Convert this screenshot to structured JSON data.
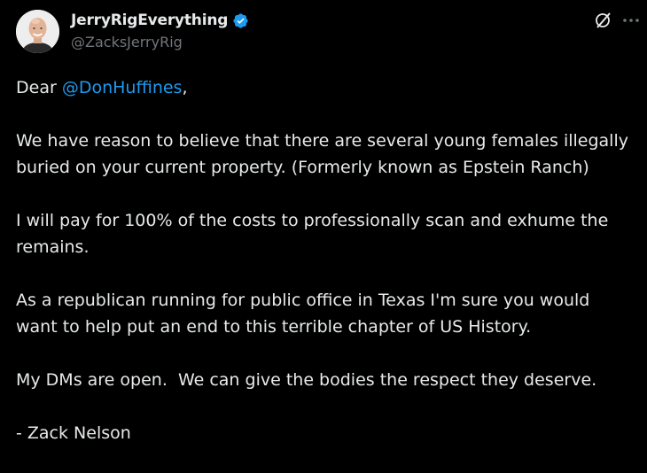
{
  "author": {
    "display_name": "JerryRigEverything",
    "handle": "@ZacksJerryRig",
    "verified": true
  },
  "icons": {
    "verified": "verified-badge-icon",
    "grok": "grok-icon",
    "more": "more-options-icon"
  },
  "colors": {
    "background": "#000000",
    "text": "#e7e9ea",
    "secondary": "#71767b",
    "accent": "#1d9bf0"
  },
  "body": {
    "greeting_prefix": "Dear ",
    "greeting_mention": "@DonHuffines",
    "greeting_suffix": ",",
    "paragraph_2": "We have reason to believe that there are several young females illegally buried on your current property. (Formerly known as Epstein Ranch)",
    "paragraph_3": "I will pay for 100% of the costs to professionally scan and exhume the remains.",
    "paragraph_4": "As a republican running for public office in Texas I'm sure you would want to help put an end to this terrible chapter of US History.",
    "paragraph_5": "My DMs are open.  We can give the bodies the respect they deserve.",
    "signature": "- Zack Nelson"
  }
}
